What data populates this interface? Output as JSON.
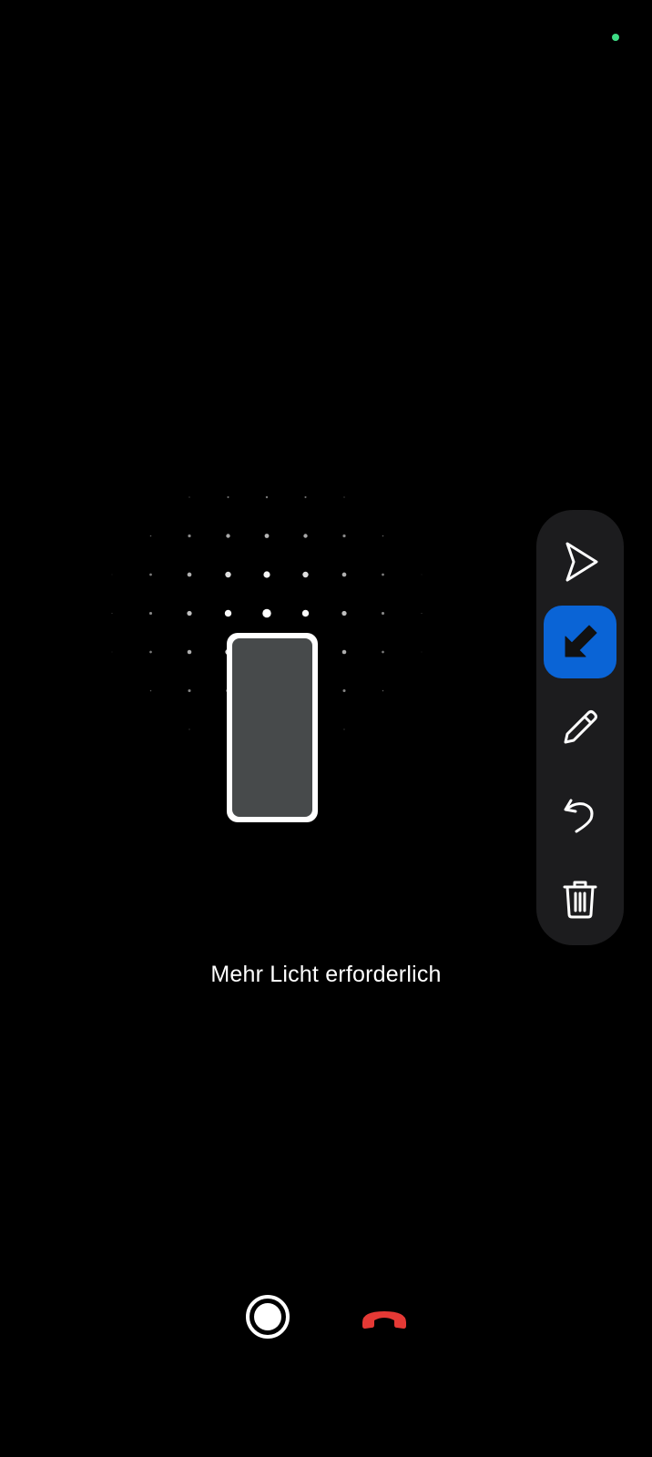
{
  "status": {
    "indicator_color": "#3ddc84"
  },
  "camera_view": {
    "hint_text": "Mehr Licht erforderlich",
    "illustration_icon": "phone-outline-icon"
  },
  "toolbar": {
    "active_tool": "arrow",
    "accent_color": "#0a64d6",
    "tools": [
      {
        "id": "pointer",
        "icon": "pointer-icon"
      },
      {
        "id": "arrow",
        "icon": "arrow-down-left-icon"
      },
      {
        "id": "draw",
        "icon": "pencil-icon"
      },
      {
        "id": "undo",
        "icon": "undo-icon"
      },
      {
        "id": "delete",
        "icon": "trash-icon"
      }
    ]
  },
  "call_controls": {
    "record_icon": "record-icon",
    "hangup_icon": "hang-up-icon",
    "hangup_color": "#e53935"
  }
}
